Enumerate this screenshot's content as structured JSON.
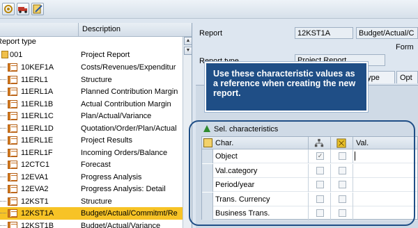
{
  "left": {
    "col_description": "Description",
    "col_type": "Report type",
    "folder": {
      "key": "001",
      "desc": "Project Report"
    },
    "rows": [
      {
        "key": "10KEF1A",
        "desc": "Costs/Revenues/Expenditur"
      },
      {
        "key": "11ERL1",
        "desc": "Structure"
      },
      {
        "key": "11ERL1A",
        "desc": "Planned Contribution Margin"
      },
      {
        "key": "11ERL1B",
        "desc": "Actual Contribution Margin"
      },
      {
        "key": "11ERL1C",
        "desc": "Plan/Actual/Variance"
      },
      {
        "key": "11ERL1D",
        "desc": "Quotation/Order/Plan/Actual"
      },
      {
        "key": "11ERL1E",
        "desc": "Project Results"
      },
      {
        "key": "11ERL1F",
        "desc": "Incoming Orders/Balance"
      },
      {
        "key": "12CTC1",
        "desc": "Forecast"
      },
      {
        "key": "12EVA1",
        "desc": "Progress Analysis"
      },
      {
        "key": "12EVA2",
        "desc": "Progress Analysis: Detail"
      },
      {
        "key": "12KST1",
        "desc": "Structure"
      },
      {
        "key": "12KST1A",
        "desc": "Budget/Actual/Commitmt/Re"
      },
      {
        "key": "12KST1B",
        "desc": "Budget/Actual/Variance"
      }
    ],
    "selected_index": 12
  },
  "right": {
    "report_label": "Report",
    "report_value": "12KST1A",
    "report_desc": "Budget/Actual/C",
    "form_label": "Form",
    "report_type_label": "Report type",
    "report_type_value": "Project Report",
    "tab_1": "tType",
    "tab_2": "Opt"
  },
  "callout": {
    "text": "Use these characteristic values as a reference when creating the new report."
  },
  "sel": {
    "title": "Sel. characteristics",
    "col_char": "Char.",
    "col_val": "Val.",
    "rows": [
      {
        "name": "Object",
        "c1": "checked"
      },
      {
        "name": "Val.category",
        "c1": ""
      },
      {
        "name": "Period/year",
        "c1": ""
      },
      {
        "name": "Trans. Currency",
        "c1": ""
      },
      {
        "name": "Business Trans.",
        "c1": ""
      }
    ]
  },
  "colors": {
    "selected_row": "#f7c326",
    "callout": "#1f4e86",
    "accent_green": "#2e8b2e"
  }
}
